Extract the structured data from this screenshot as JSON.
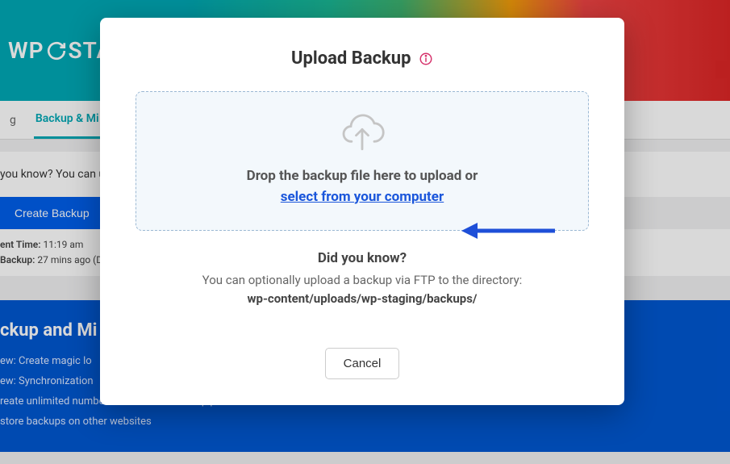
{
  "banner": {
    "logo_prefix": "WP",
    "logo_suffix": "STA"
  },
  "tabs": {
    "staging_partial": "g",
    "backup_migration_partial": "Backup & Mi"
  },
  "info_bar": {
    "text_partial": "you know? You can u"
  },
  "buttons": {
    "create_backup": "Create Backup"
  },
  "meta": {
    "current_time_label": "ent Time:",
    "current_time_value": "11:19 am",
    "backup_label": "Backup:",
    "backup_value": "27 mins ago (D"
  },
  "blue_panel": {
    "heading_partial": "ckup and Mi",
    "items": [
      "ew: Create magic lo",
      "ew: Synchronization",
      "reate unlimited number of scheduled backup plans",
      "store backups on other websites"
    ]
  },
  "modal": {
    "title": "Upload Backup",
    "drop_text": "Drop the backup file here to upload or",
    "select_link": "select from your computer",
    "did_you_know_heading": "Did you know?",
    "did_you_know_text": "You can optionally upload a backup via FTP to the directory:",
    "did_you_know_path": "wp-content/uploads/wp-staging/backups/",
    "cancel": "Cancel"
  },
  "colors": {
    "accent": "#00a8b5",
    "link": "#1a56db",
    "info_icon": "#d6336c",
    "arrow": "#1e4fd8",
    "primary_btn": "#005eea",
    "blue_panel": "#0057d1"
  }
}
